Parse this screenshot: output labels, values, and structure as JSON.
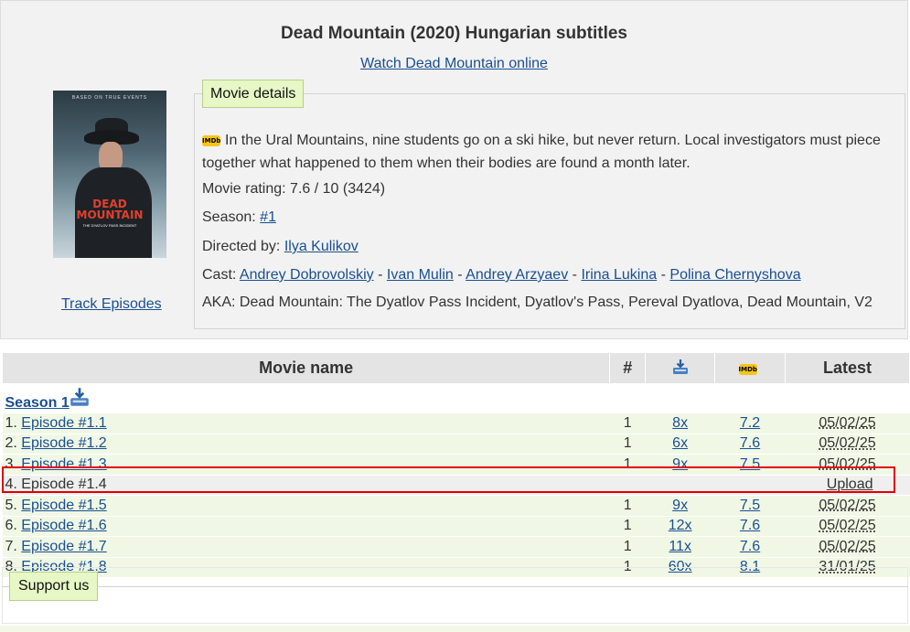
{
  "page": {
    "title": "Dead Mountain (2020) Hungarian subtitles",
    "watch_link": "Watch Dead Mountain online",
    "track_link": "Track Episodes"
  },
  "poster": {
    "tag": "BASED ON TRUE EVENTS",
    "title_line1": "DEAD",
    "title_line2": "MOUNTAIN",
    "subtitle": "THE DYATLOV PASS INCIDENT"
  },
  "details": {
    "legend": "Movie details",
    "imdb_badge": "IMDb",
    "description": "In the Ural Mountains, nine students go on a ski hike, but never return. Local investigators must piece together what happened to them when their bodies are found a month later.",
    "rating_label": "Movie rating:",
    "rating_value": "7.6 / 10 (3424)",
    "season_label": "Season:",
    "season_link": "#1",
    "directed_label": "Directed by:",
    "director": "Ilya Kulikov",
    "cast_label": "Cast:",
    "cast": [
      "Andrey Dobrovolskiy",
      "Ivan Mulin",
      "Andrey Arzyaev",
      "Irina Lukina",
      "Polina Chernyshova"
    ],
    "cast_separator": "-",
    "aka_label": "AKA:",
    "aka_value": "Dead Mountain: The Dyatlov Pass Incident, Dyatlov's Pass, Pereval Dyatlova, Dead Mountain, V2"
  },
  "table": {
    "headers": {
      "name": "Movie name",
      "num": "#",
      "download_icon": "download-icon",
      "imdb_icon": "IMDb",
      "latest": "Latest"
    },
    "season_label": "Season 1",
    "rows": [
      {
        "index": "1.",
        "episode": "Episode #1.1",
        "num": "1",
        "downloads": "8x",
        "rating": "7.2",
        "latest": "05/02/25"
      },
      {
        "index": "2.",
        "episode": "Episode #1.2",
        "num": "1",
        "downloads": "6x",
        "rating": "7.6",
        "latest": "05/02/25"
      },
      {
        "index": "3.",
        "episode": "Episode #1.3",
        "num": "1",
        "downloads": "9x",
        "rating": "7.5",
        "latest": "05/02/25"
      },
      {
        "index": "4.",
        "episode": "Episode #1.4",
        "num": "",
        "downloads": "",
        "rating": "",
        "latest": "Upload"
      },
      {
        "index": "5.",
        "episode": "Episode #1.5",
        "num": "1",
        "downloads": "9x",
        "rating": "7.5",
        "latest": "05/02/25"
      },
      {
        "index": "6.",
        "episode": "Episode #1.6",
        "num": "1",
        "downloads": "12x",
        "rating": "7.6",
        "latest": "05/02/25"
      },
      {
        "index": "7.",
        "episode": "Episode #1.7",
        "num": "1",
        "downloads": "11x",
        "rating": "7.6",
        "latest": "05/02/25"
      },
      {
        "index": "8.",
        "episode": "Episode #1.8",
        "num": "1",
        "downloads": "60x",
        "rating": "8.1",
        "latest": "31/01/25"
      }
    ]
  },
  "support": {
    "label": "Support us"
  },
  "colors": {
    "link": "#1a4f91",
    "legend_bg": "#e7f7c5",
    "row_bg": "#f0f8e5",
    "highlight": "#e00000",
    "imdb": "#f5c518"
  }
}
